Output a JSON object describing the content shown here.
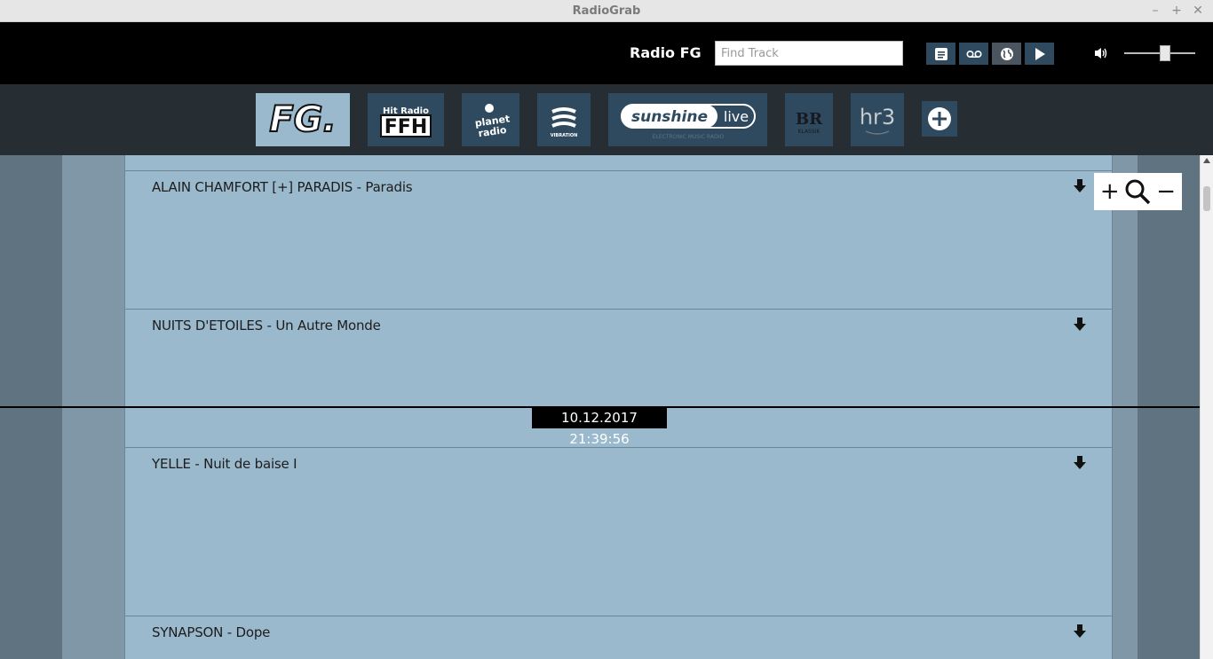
{
  "window": {
    "title": "RadioGrab",
    "controls": [
      "–",
      "+",
      "✕"
    ]
  },
  "toolbar": {
    "station_name": "Radio FG",
    "search_placeholder": "Find Track",
    "buttons": [
      "playlist-icon",
      "voicemail-icon",
      "globe-icon",
      "play-icon"
    ],
    "volume_level": 0.58
  },
  "stations": [
    {
      "name": "FG.",
      "selected": true
    },
    {
      "name": "Hit Radio FFH",
      "selected": false
    },
    {
      "name": "planet radio",
      "selected": false
    },
    {
      "name": "VIBRATION",
      "selected": false
    },
    {
      "name": "sunshine live",
      "selected": false
    },
    {
      "name": "BR KLASSIK",
      "selected": false
    },
    {
      "name": "hr3",
      "selected": false
    }
  ],
  "tracks": [
    {
      "title": "ALAIN CHAMFORT [+] PARADIS - Paradis"
    },
    {
      "title": "NUITS D'ETOILES - Un Autre Monde"
    },
    {
      "title": "YELLE - Nuit de baise I"
    },
    {
      "title": "SYNAPSON - Dope"
    }
  ],
  "current_time": "10.12.2017 21:39:56",
  "zoom": {
    "plus": "+",
    "minus": "−"
  }
}
